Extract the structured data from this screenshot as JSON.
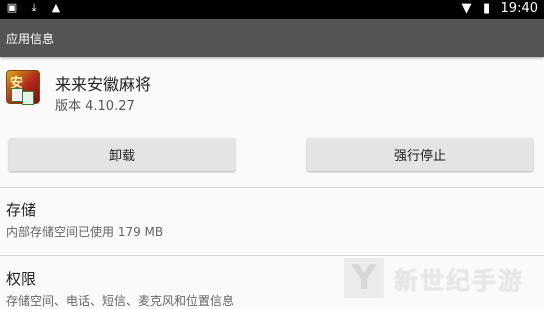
{
  "status_bar": {
    "left_icons": [
      "image-icon",
      "download-icon",
      "android-icon"
    ],
    "time": "19:40",
    "right_icons": [
      "wifi-icon",
      "battery-icon"
    ]
  },
  "action_bar": {
    "title": "应用信息"
  },
  "app": {
    "name": "来来安徽麻将",
    "version": "版本 4.10.27"
  },
  "buttons": {
    "uninstall": "卸载",
    "force_stop": "强行停止"
  },
  "storage": {
    "title": "存储",
    "summary": "内部存储空间已使用 179 MB"
  },
  "permissions": {
    "title": "权限",
    "summary": "存储空间、电话、短信、麦克风和位置信息"
  },
  "watermark": {
    "text": "新世纪手游",
    "logo_glyph": "Y"
  }
}
